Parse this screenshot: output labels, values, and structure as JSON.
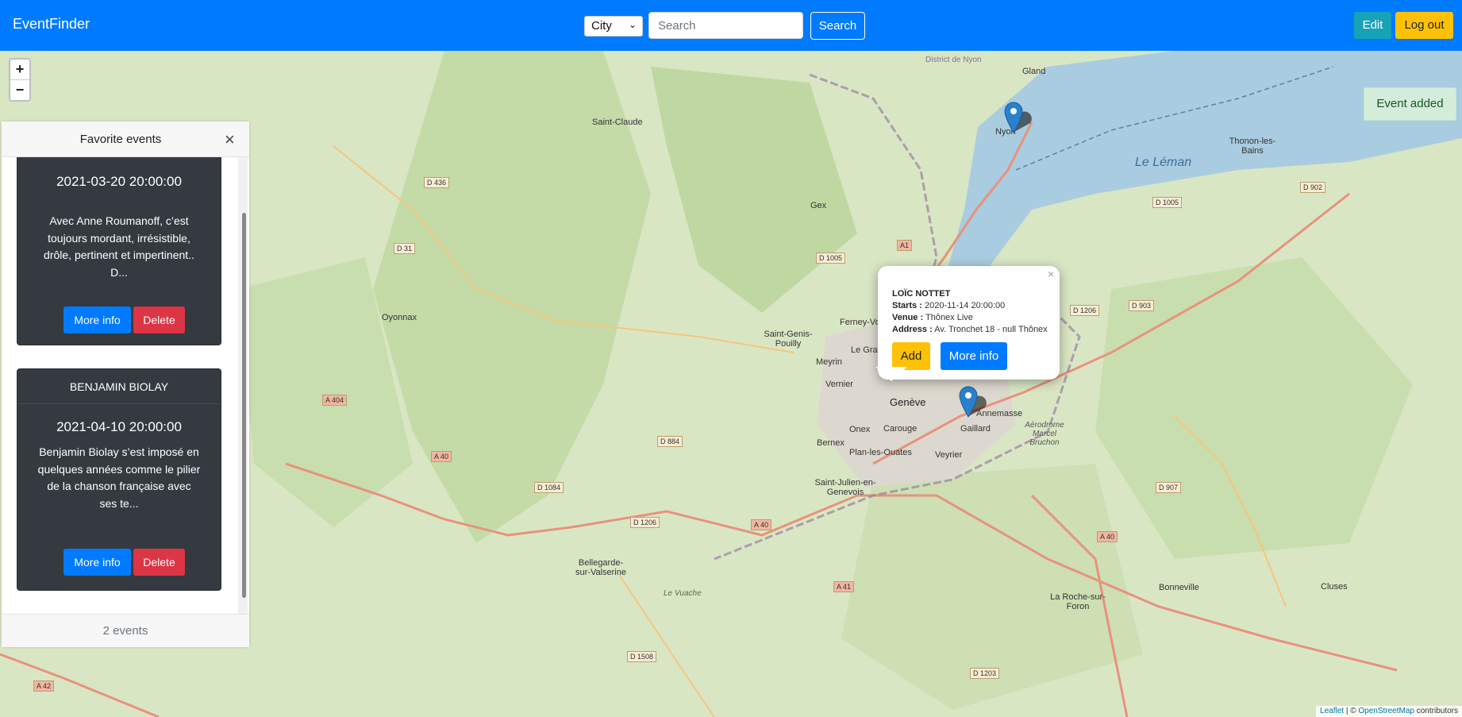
{
  "navbar": {
    "brand": "EventFinder",
    "filter_select": "City",
    "search_placeholder": "Search",
    "search_button": "Search",
    "edit_button": "Edit",
    "logout_button": "Log out"
  },
  "map": {
    "zoom_in": "+",
    "zoom_out": "−",
    "labels": {
      "gland": "Gland",
      "district_nyon": "District de Nyon",
      "saint_claude": "Saint-Claude",
      "nyon": "Nyon",
      "thonon": "Thonon-les-Bains",
      "le_leman": "Le Léman",
      "gex": "Gex",
      "oyonnax": "Oyonnax",
      "saint_genis": "Saint-Genis-Pouilly",
      "ferney": "Ferney-Vol",
      "le_grand": "Le Gran",
      "meyrin": "Meyrin",
      "vernier": "Vernier",
      "geneve": "Genève",
      "annemasse": "Annemasse",
      "aerodrome": "Aérodrome Marcel Bruchon",
      "gaillard": "Gaillard",
      "onex": "Onex",
      "carouge": "Carouge",
      "bernex": "Bernex",
      "plan_les_ouates": "Plan-les-Ouates",
      "veyrier": "Veyrier",
      "saint_julien": "Saint-Julien-en-Genevois",
      "bellegarde": "Bellegarde-sur-Valserine",
      "la_roche": "La Roche-sur-Foron",
      "bonneville": "Bonneville",
      "cluses": "Cluses",
      "le_vuache": "Le Vuache"
    },
    "roads": {
      "d436": "D 436",
      "d31": "D 31",
      "d1005a": "D 1005",
      "d1005b": "D 1005",
      "d902": "D 902",
      "a1": "A1",
      "d1206a": "D 1206",
      "d903": "D 903",
      "a404": "A 404",
      "a40a": "A 40",
      "d884": "D 884",
      "d1084": "D 1084",
      "d1206b": "D 1206",
      "a40b": "A 40",
      "d907": "D 907",
      "a40c": "A 40",
      "a41": "A 41",
      "d1508": "D 1508",
      "d1203": "D 1203",
      "a42": "A 42"
    },
    "attribution": {
      "leaflet": "Leaflet",
      "sep": " | © ",
      "osm": "OpenStreetMap",
      "suffix": " contributors"
    }
  },
  "favorites": {
    "title": "Favorite events",
    "close": "×",
    "count_text": "2 events",
    "events": [
      {
        "date": "2021-03-20 20:00:00",
        "description": "Avec Anne Roumanoff, c’est toujours mordant, irrésistible, drôle, pertinent et impertinent.. D...",
        "more_info": "More info",
        "delete": "Delete"
      },
      {
        "name": "BENJAMIN BIOLAY",
        "date": "2021-04-10 20:00:00",
        "description": "Benjamin Biolay s’est imposé en quelques années comme le pilier de la chanson française avec ses te...",
        "more_info": "More info",
        "delete": "Delete"
      }
    ]
  },
  "popup": {
    "close": "×",
    "title": "LOÏC NOTTET",
    "starts_label": "Starts :",
    "starts_value": "2020-11-14 20:00:00",
    "venue_label": "Venue :",
    "venue_value": "Thônex Live",
    "address_label": "Address :",
    "address_value": "Av. Tronchet 18 - null Thônex",
    "add_button": "Add",
    "more_info_button": "More info"
  },
  "toast": "Event added",
  "colors": {
    "primary": "#007bff",
    "info": "#17a2b8",
    "warning": "#ffc107",
    "danger": "#dc3545",
    "card_dark": "#343a40",
    "success_bg": "#d4edda"
  }
}
